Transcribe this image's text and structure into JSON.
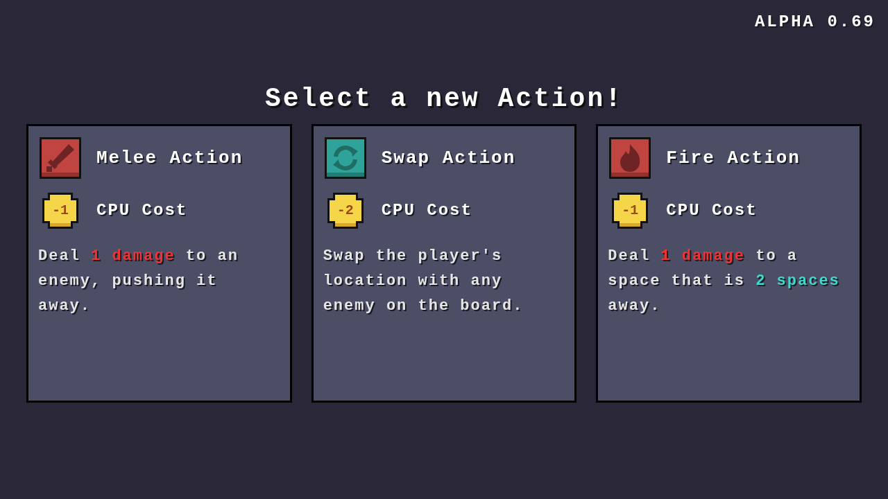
{
  "version": "ALPHA 0.69",
  "title": "Select a new Action!",
  "cards": [
    {
      "kind": "sword",
      "name": "Melee Action",
      "cost": "-1",
      "cost_label": "CPU Cost",
      "description": [
        {
          "text": "Deal ",
          "color": "#e6e6e6"
        },
        {
          "text": "1 damage",
          "color": "#ee3333"
        },
        {
          "text": " to an enemy, pushing it away.",
          "color": "#e6e6e6"
        }
      ]
    },
    {
      "kind": "swap",
      "name": "Swap Action",
      "cost": "-2",
      "cost_label": "CPU Cost",
      "description": [
        {
          "text": "Swap the player's location with any enemy on the board.",
          "color": "#e6e6e6"
        }
      ]
    },
    {
      "kind": "fire",
      "name": "Fire Action",
      "cost": "-1",
      "cost_label": "CPU Cost",
      "description": [
        {
          "text": "Deal ",
          "color": "#e6e6e6"
        },
        {
          "text": "1 damage",
          "color": "#ee3333"
        },
        {
          "text": " to a space that is ",
          "color": "#e6e6e6"
        },
        {
          "text": "2 spaces",
          "color": "#40d8cc"
        },
        {
          "text": " away.",
          "color": "#e6e6e6"
        }
      ]
    }
  ]
}
